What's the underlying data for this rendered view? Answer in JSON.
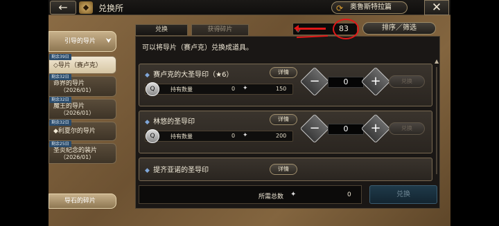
{
  "header": {
    "back_label": "←",
    "title": "兑换所",
    "chapter_label": "奥鲁斯特拉篇",
    "close_label": "✕"
  },
  "sidebar": {
    "section_title": "引导的导片",
    "items": [
      {
        "badge": "剩余39日",
        "label": "◇导片（赛卢克）",
        "sub": "",
        "active": true
      },
      {
        "badge": "剩余32日",
        "label": "命界的导片",
        "sub": "（2026/01）"
      },
      {
        "badge": "剩余32日",
        "label": "魔王的导片",
        "sub": "（2026/01）"
      },
      {
        "badge": "剩余32日",
        "label": "◆利夏尔的导片",
        "sub": ""
      },
      {
        "badge": "剩余25日",
        "label": "圣炎纪念的装片",
        "sub": "（2026/01）"
      }
    ],
    "bottom_label": "导石的碎片"
  },
  "tabs": [
    {
      "label": "兑换"
    },
    {
      "label": "获得碎片"
    }
  ],
  "currency": {
    "value": "83"
  },
  "sort_label": "排序／筛选",
  "intro_text": "可以将导片（赛卢克）兑换成道具。",
  "items": [
    {
      "name": "赛卢克的大圣导印（★6）",
      "detail": "详情",
      "owned_label": "持有数量",
      "owned": "0",
      "cost": "150",
      "qty": "0",
      "exchange": "兑换"
    },
    {
      "name": "林悠的圣导印",
      "detail": "详情",
      "owned_label": "持有数量",
      "owned": "0",
      "cost": "200",
      "qty": "0",
      "exchange": "兑换"
    },
    {
      "name": "提齐亚诺的圣导印",
      "detail": "详情"
    }
  ],
  "footer": {
    "total_label": "所需总数",
    "total_value": "0",
    "exchange_label": "兑换"
  },
  "colors": {
    "annotation_red": "#e01818",
    "parchment": "#7a5d38",
    "panel": "#1a1715"
  }
}
